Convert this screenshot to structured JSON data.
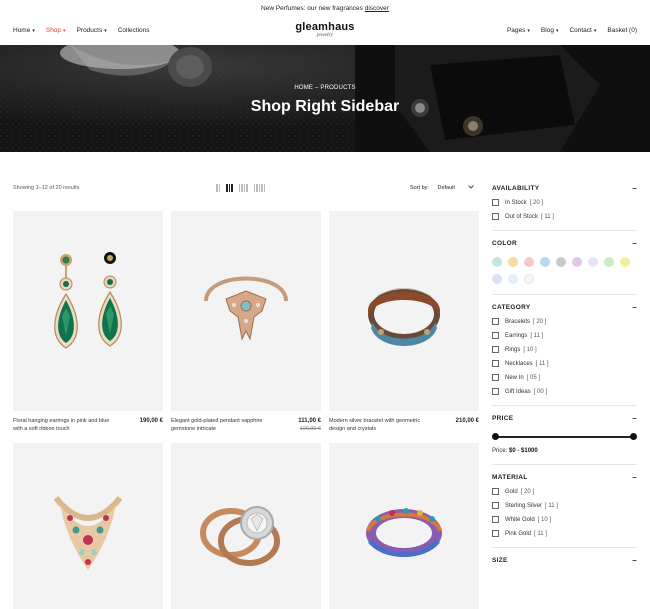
{
  "announcement": {
    "text": "New Perfumes: our new fragrances",
    "link": "discover"
  },
  "nav": {
    "left": [
      {
        "label": "Home",
        "dropdown": true,
        "active": false
      },
      {
        "label": "Shop",
        "dropdown": true,
        "active": true
      },
      {
        "label": "Products",
        "dropdown": true,
        "active": false
      },
      {
        "label": "Collections",
        "dropdown": false,
        "active": false
      }
    ],
    "right": [
      {
        "label": "Pages",
        "dropdown": true
      },
      {
        "label": "Blog",
        "dropdown": true
      },
      {
        "label": "Contact",
        "dropdown": true
      },
      {
        "label": "Basket (0)",
        "dropdown": false
      }
    ],
    "caret": "▾"
  },
  "logo": {
    "name": "gleamhaus",
    "tagline": "jewelry"
  },
  "hero": {
    "breadcrumb": "HOME  –  PRODUCTS",
    "title": "Shop Right Sidebar"
  },
  "toolbar": {
    "results": "Showing 1–12 of 20 results",
    "sort_label": "Sort by:",
    "sort_value": "Default",
    "sort_icon": "chevron-down-icon",
    "layouts": [
      {
        "cols": 2,
        "active": false
      },
      {
        "cols": 3,
        "active": true
      },
      {
        "cols": 4,
        "active": false
      },
      {
        "cols": 5,
        "active": false
      }
    ]
  },
  "products": [
    {
      "name": "Floral hanging earrings in pink and blue with a soft ribbon touch",
      "price": "190,00 €",
      "old_price": ""
    },
    {
      "name": "Elegant gold-plated pendant sapphire gemstone intricate",
      "price": "111,00 €",
      "old_price": "100,00 €"
    },
    {
      "name": "Modern silver bracelet with geometric design and crystals",
      "price": "210,00 €",
      "old_price": ""
    },
    {
      "name": "",
      "price": "",
      "old_price": ""
    },
    {
      "name": "",
      "price": "",
      "old_price": ""
    },
    {
      "name": "",
      "price": "",
      "old_price": ""
    }
  ],
  "sidebar": {
    "availability": {
      "title": "AVAILABILITY",
      "items": [
        {
          "label": "In Stock",
          "count": "[ 20 ]"
        },
        {
          "label": "Out of Stock",
          "count": "[ 11 ]"
        }
      ]
    },
    "color": {
      "title": "COLOR",
      "swatches": [
        "#bfe7e2",
        "#f6dd9e",
        "#f6c9c5",
        "#b9d6f2",
        "#c9c9c9",
        "#e3c6e6",
        "#e9e4f5",
        "#c6edc4",
        "#f1f19a",
        "#dbe0f5",
        "#e3eefb",
        "#f6f6f6"
      ]
    },
    "category": {
      "title": "CATEGORY",
      "items": [
        {
          "label": "Bracelets",
          "count": "[ 20 ]"
        },
        {
          "label": "Earrings",
          "count": "[ 11 ]"
        },
        {
          "label": "Rings",
          "count": "[ 10 ]"
        },
        {
          "label": "Necklaces",
          "count": "[ 11 ]"
        },
        {
          "label": "New In",
          "count": "[ 05 ]"
        },
        {
          "label": "Gift Ideas",
          "count": "[ 00 ]"
        }
      ]
    },
    "price": {
      "title": "PRICE",
      "label": "Price:",
      "range": "$0 - $1000",
      "min": 0,
      "max": 1000
    },
    "material": {
      "title": "MATERIAL",
      "items": [
        {
          "label": "Gold",
          "count": "[ 20 ]"
        },
        {
          "label": "Sterling Silver",
          "count": "[ 11 ]"
        },
        {
          "label": "White Gold",
          "count": "[ 10 ]"
        },
        {
          "label": "Pink Gold",
          "count": "[ 11 ]"
        }
      ]
    },
    "size": {
      "title": "SIZE"
    },
    "toggle": "–"
  }
}
